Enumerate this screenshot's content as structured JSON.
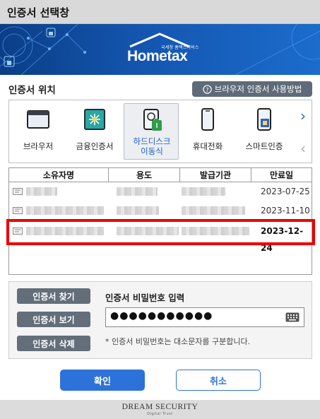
{
  "window": {
    "title": "인증서 선택창"
  },
  "banner": {
    "logo_text": "Hometax",
    "logo_sub": "국세청 홈택스서비스"
  },
  "location": {
    "label": "인증서 위치",
    "help_button": "브라우저 인증서 사용방법"
  },
  "media_items": [
    {
      "label": "브라우저",
      "icon": "browser-window-icon"
    },
    {
      "label": "금융인증서",
      "icon": "financial-cert-icon"
    },
    {
      "label": "하드디스크\n이동식",
      "icon": "hard-disk-icon",
      "selected": true
    },
    {
      "label": "휴대전화",
      "icon": "mobile-phone-icon"
    },
    {
      "label": "스마트인증",
      "icon": "smart-auth-icon"
    }
  ],
  "table": {
    "headers": [
      "소유자명",
      "용도",
      "발급기관",
      "만료일"
    ],
    "rows": [
      {
        "expiry": "2023-07-25",
        "selected": false
      },
      {
        "expiry": "2023-11-10",
        "selected": false
      },
      {
        "expiry": "2023-12-24",
        "selected": true
      }
    ]
  },
  "actions": {
    "find": "인증서 찾기",
    "view": "인증서 보기",
    "delete": "인증서 삭제"
  },
  "password": {
    "label": "인증서 비밀번호 입력",
    "value": "●●●●●●●●●●●",
    "note": "* 인증서 비밀번호는 대소문자를 구분합니다."
  },
  "buttons": {
    "ok": "확인",
    "cancel": "취소"
  },
  "footer": {
    "brand": "DREAM SECURITY",
    "tagline": "Digital Trust"
  },
  "colors": {
    "accent": "#2d72d9",
    "selection_border": "#ee0000",
    "banner": "#1456b0"
  }
}
